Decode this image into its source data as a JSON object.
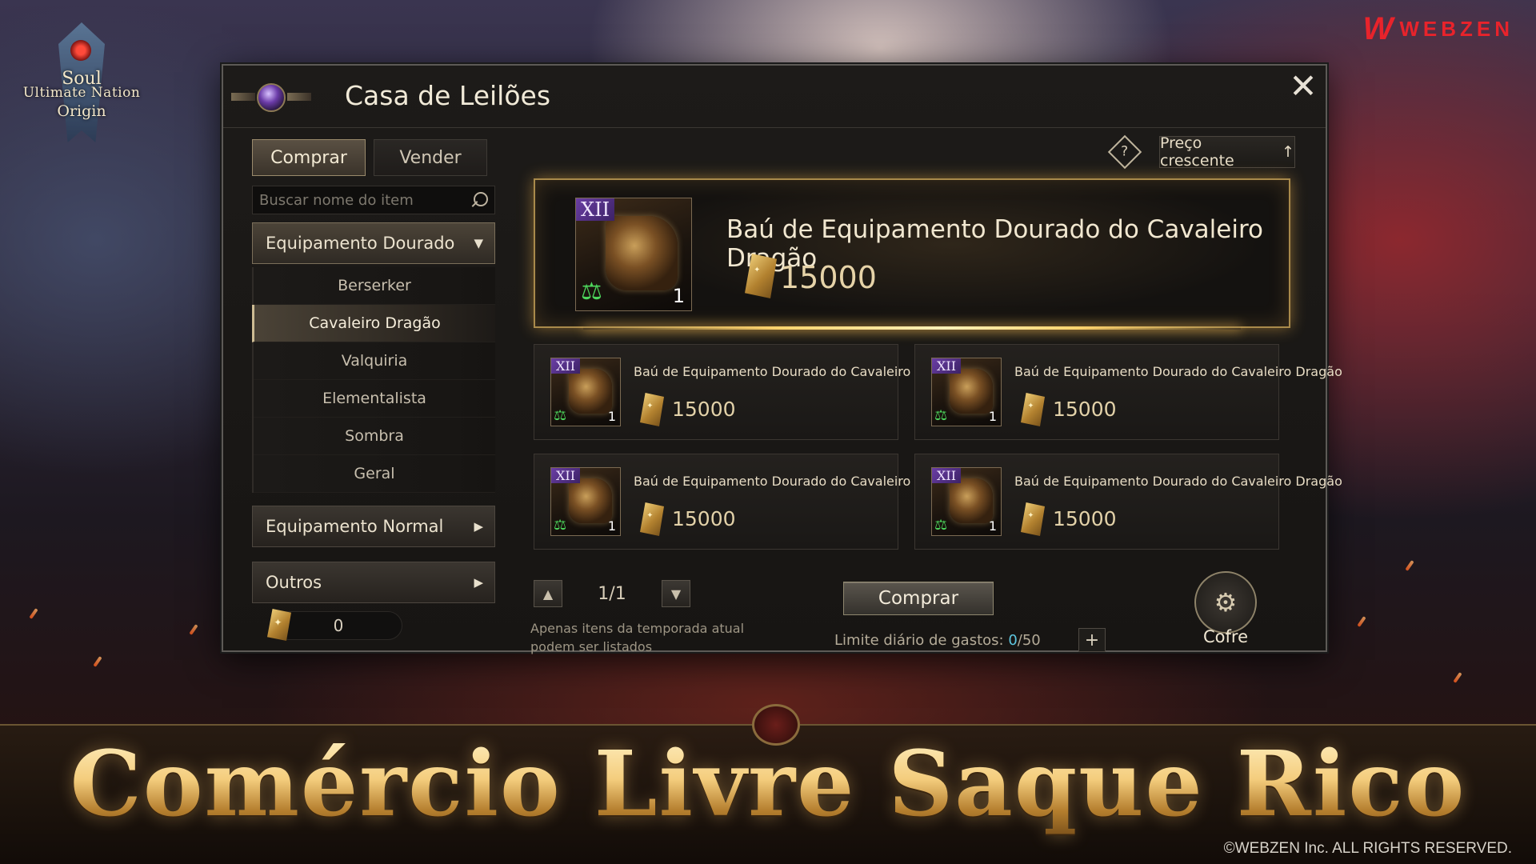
{
  "brand": {
    "logo_line1": "Soul",
    "logo_line2": "Ultimate Nation",
    "logo_line3": "Origin",
    "publisher": "WEBZEN"
  },
  "window": {
    "title": "Casa de Leilões"
  },
  "tabs": [
    {
      "label": "Comprar",
      "active": true
    },
    {
      "label": "Vender",
      "active": false
    }
  ],
  "search": {
    "placeholder": "Buscar nome do item"
  },
  "categories": {
    "golden": {
      "label": "Equipamento Dourado",
      "expanded": true
    },
    "normal": {
      "label": "Equipamento Normal",
      "expanded": false
    },
    "others": {
      "label": "Outros",
      "expanded": false
    }
  },
  "subcategories": [
    {
      "label": "Berserker",
      "active": false
    },
    {
      "label": "Cavaleiro Dragão",
      "active": true
    },
    {
      "label": "Valquiria",
      "active": false
    },
    {
      "label": "Elementalista",
      "active": false
    },
    {
      "label": "Sombra",
      "active": false
    },
    {
      "label": "Geral",
      "active": false
    }
  ],
  "currency_balance": "0",
  "help_icon": "?",
  "sort": {
    "label": "Preço crescente",
    "direction_icon": "↑"
  },
  "featured": {
    "tier": "XII",
    "qty": "1",
    "name": "Baú de Equipamento Dourado do Cavaleiro Dragão",
    "price": "15000"
  },
  "listings": [
    {
      "tier": "XII",
      "qty": "1",
      "name": "Baú de Equipamento Dourado do Cavaleiro Dragão",
      "price": "15000"
    },
    {
      "tier": "XII",
      "qty": "1",
      "name": "Baú de Equipamento Dourado do Cavaleiro Dragão",
      "price": "15000"
    },
    {
      "tier": "XII",
      "qty": "1",
      "name": "Baú de Equipamento Dourado do Cavaleiro Dragão",
      "price": "15000"
    },
    {
      "tier": "XII",
      "qty": "1",
      "name": "Baú de Equipamento Dourado do Cavaleiro Dragão",
      "price": "15000"
    }
  ],
  "pager": {
    "current": "1/1",
    "note_line1": "Apenas itens da temporada atual",
    "note_line2": "podem ser listados"
  },
  "buy_button": "Comprar",
  "limit": {
    "label": "Limite diário de gastos:",
    "used": "0",
    "max": "/50"
  },
  "vault": {
    "label": "Cofre"
  },
  "banner": {
    "text": "Comércio Livre Saque Rico",
    "copyright": "©WEBZEN Inc. ALL RIGHTS RESERVED."
  },
  "colors": {
    "accent_gold": "#f2c978",
    "tier_purple": "#6a3ea4",
    "limit_used": "#5ec7e0",
    "publisher_red": "#e8232b"
  }
}
